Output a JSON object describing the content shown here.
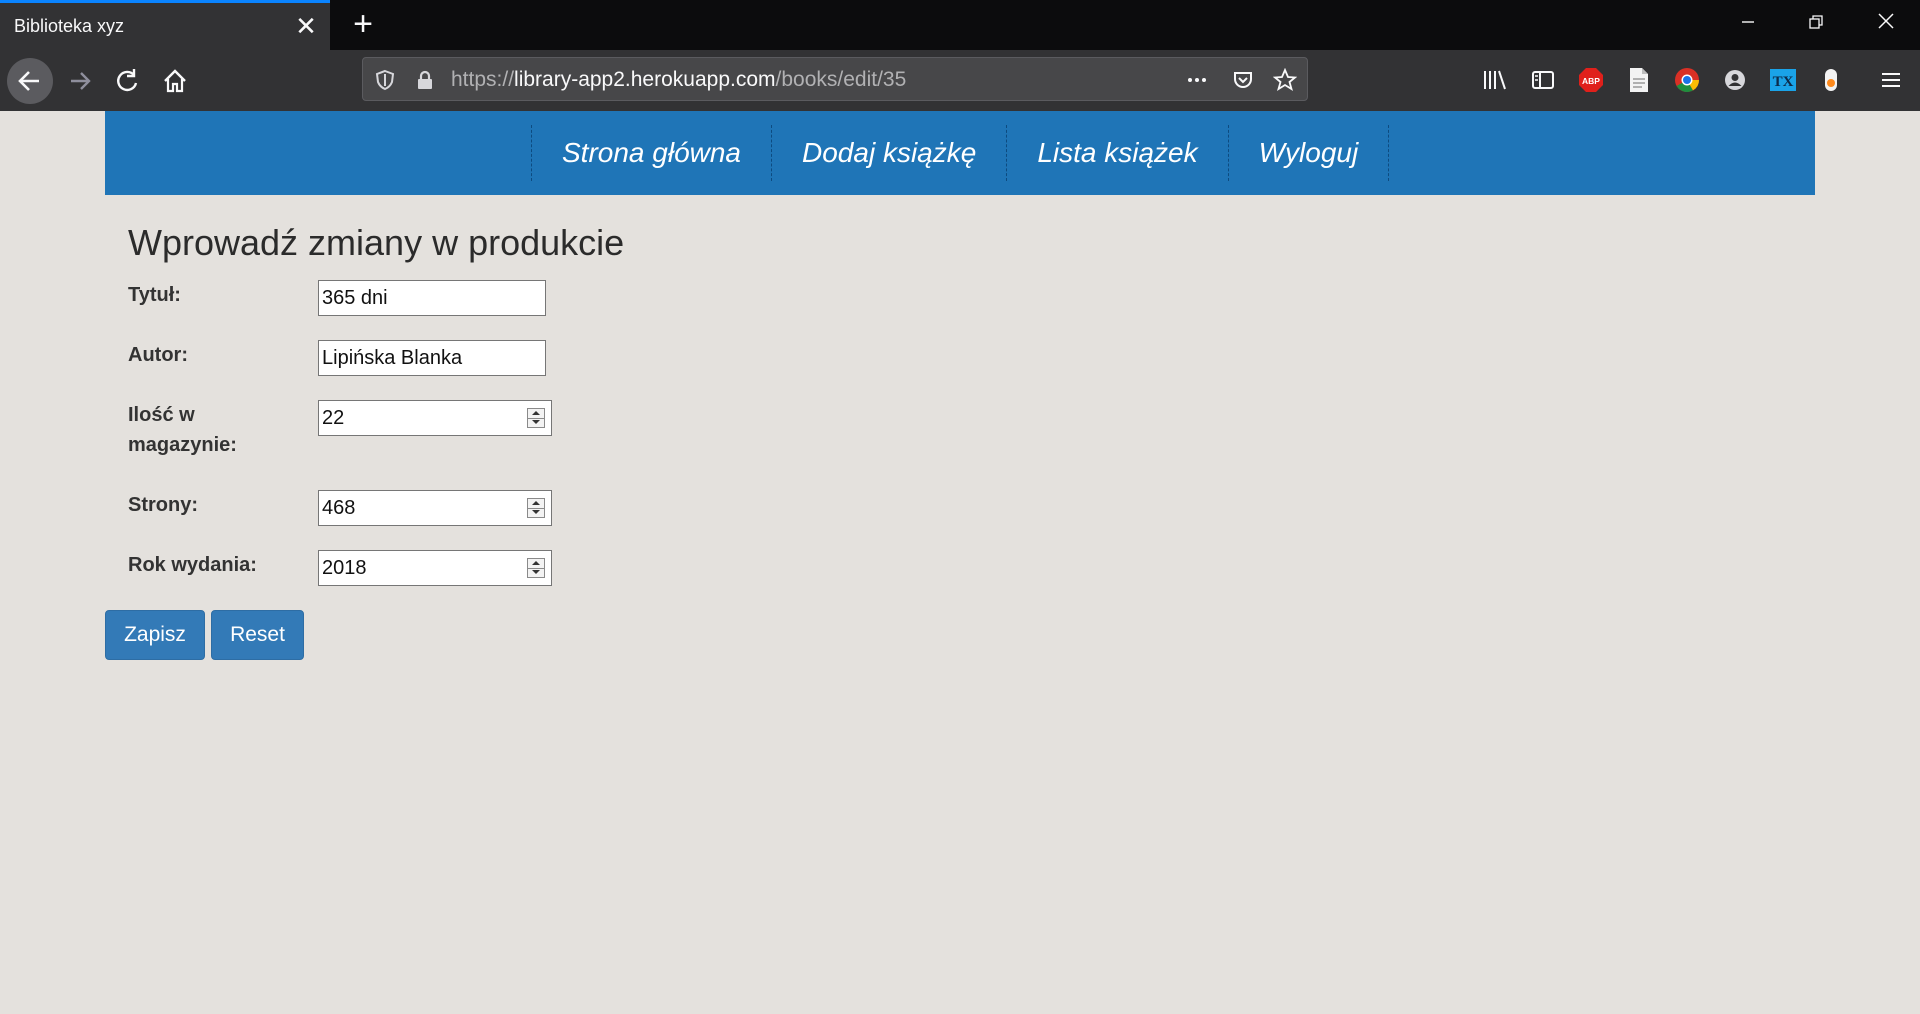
{
  "browser": {
    "tab_title": "Biblioteka xyz",
    "url_prefix": "https://",
    "url_host": "library-app2.herokuapp.com",
    "url_path": "/books/edit/35",
    "extensions": [
      "library-icon",
      "sidebar-icon",
      "adblock-plus-icon",
      "reader-icon",
      "chrome-icon",
      "account-icon",
      "tx-icon",
      "extension-icon",
      "menu-icon"
    ],
    "abp_label": "ABP",
    "tx_label": "TX",
    "accent": "#0a84ff"
  },
  "nav": {
    "items": [
      {
        "label": "Strona główna"
      },
      {
        "label": "Dodaj książkę"
      },
      {
        "label": "Lista książek"
      },
      {
        "label": "Wyloguj"
      }
    ],
    "bg": "#1f75b7"
  },
  "form": {
    "heading": "Wprowadź zmiany w produkcie",
    "title_label": "Tytuł:",
    "title_value": "365 dni",
    "author_label": "Autor:",
    "author_value": "Lipińska Blanka",
    "stock_label": "Ilość w magazynie:",
    "stock_value": "22",
    "pages_label": "Strony:",
    "pages_value": "468",
    "year_label": "Rok wydania:",
    "year_value": "2018",
    "save_label": "Zapisz",
    "reset_label": "Reset"
  }
}
